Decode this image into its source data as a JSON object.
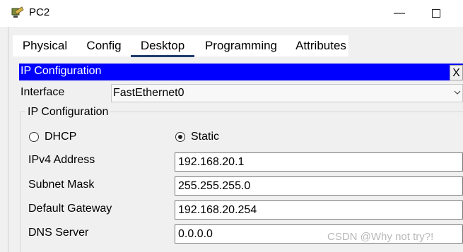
{
  "window": {
    "title": "PC2",
    "minimize_glyph": "—"
  },
  "tabs": [
    {
      "label": "Physical"
    },
    {
      "label": "Config"
    },
    {
      "label": "Desktop",
      "active": true
    },
    {
      "label": "Programming"
    },
    {
      "label": "Attributes"
    }
  ],
  "ip_config": {
    "header": "IP Configuration",
    "close_label": "X",
    "interface_label": "Interface",
    "interface_value": "FastEthernet0",
    "group_title": "IP Configuration",
    "dhcp_label": "DHCP",
    "static_label": "Static",
    "mode_selected": "Static",
    "ipv4_label": "IPv4 Address",
    "ipv4_value": "192.168.20.1",
    "subnet_label": "Subnet Mask",
    "subnet_value": "255.255.255.0",
    "gateway_label": "Default Gateway",
    "gateway_value": "192.168.20.254",
    "dns_label": "DNS Server",
    "dns_value": "0.0.0.0"
  },
  "watermark": "CSDN @Why not try?!",
  "icons": [
    "app-icon",
    "window-minimize-icon",
    "window-maximize-icon",
    "close-icon",
    "chevron-down-icon"
  ],
  "colors": {
    "header_bg": "#0000ff",
    "header_text": "#ffffff",
    "tab_underline": "#1f3d6e",
    "panel_bg": "#f0f0f0"
  }
}
